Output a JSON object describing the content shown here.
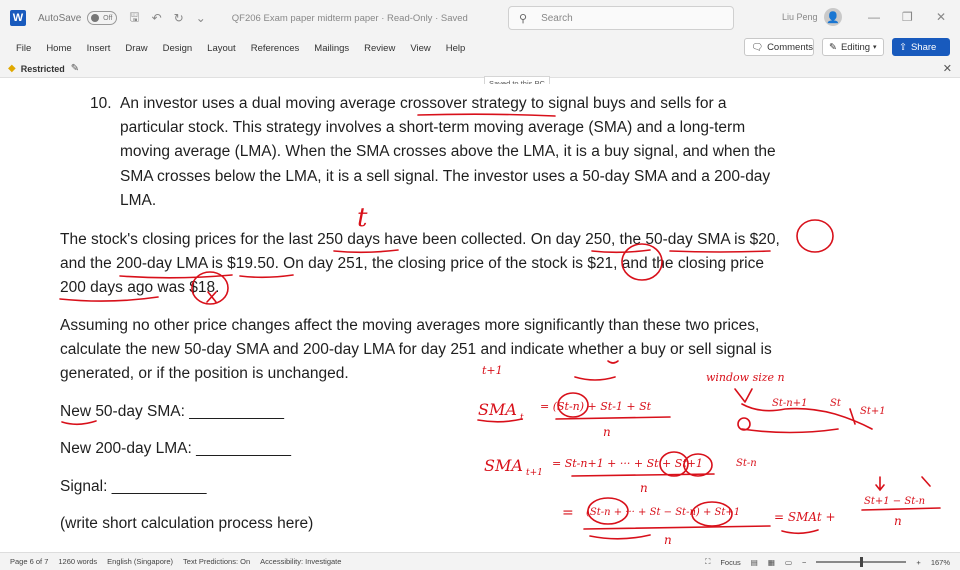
{
  "titlebar": {
    "app_letter": "W",
    "autosave_label": "AutoSave",
    "autosave_state": "Off",
    "doc_title": "QF206 Exam paper midterm paper  ·  Read-Only  ·  Saved",
    "search_placeholder": "Search",
    "user_name": "Liu Peng",
    "avatar_glyph": "👤"
  },
  "ribbon": {
    "tabs": [
      "File",
      "Home",
      "Insert",
      "Draw",
      "Design",
      "Layout",
      "References",
      "Mailings",
      "Review",
      "View",
      "Help"
    ],
    "comments_label": "Comments",
    "editing_label": "Editing",
    "share_label": "Share"
  },
  "restricted_bar": {
    "label": "Restricted"
  },
  "saved_tooltip": "Saved to this PC",
  "document": {
    "question_number": "10.",
    "question_lines": [
      "An investor uses a dual moving average crossover strategy to signal buys and sells for a",
      "particular stock. This strategy involves a short-term moving average (SMA) and a long-term",
      "moving average (LMA). When the SMA crosses above the LMA, it is a buy signal, and when the",
      "SMA crosses below the LMA, it is a sell signal. The investor uses a 50-day SMA and a 200-day",
      "LMA."
    ],
    "stock_lines": [
      "The stock's closing prices for the last 250 days have been collected. On day 250, the 50-day SMA is $20,",
      "and the 200-day LMA is $19.50. On day 251, the closing price of the stock is $21, and the closing price",
      "200 days ago was $18."
    ],
    "assume_lines": [
      "Assuming no other price changes affect the moving averages more significantly than these two prices,",
      "calculate the new 50-day SMA and 200-day LMA for day 251 and indicate whether a buy or sell signal is",
      "generated, or if the position is unchanged."
    ],
    "fill_lines": [
      "New 50-day SMA: ___________",
      "New 200-day LMA: ___________",
      "Signal: ___________",
      "(write short calculation process here)"
    ]
  },
  "annotations": {
    "t_mark": "t",
    "t_plus_1": "t+1",
    "window_size": "window size  n",
    "sma_t": "SMA",
    "sma_t_sub": "t",
    "eq1_rhs": "= (St-n) + St-1 + St",
    "eq1_den": "n",
    "sma_t1": "SMA",
    "sma_t1_sub": "t+1",
    "eq2_rhs": "= St-n+1 + ··· + St + St+1",
    "eq2_den": "n",
    "eq3_lhs": "=",
    "eq3_rhs": "(St-n + ··· + St − St-n) + St+1",
    "eq3_den": "n",
    "eq3_result": "= SMAt +",
    "eq3_frac_num": "St+1 − St-n",
    "eq3_frac_den": "n",
    "diagram_labels": [
      "St-n+1",
      "St",
      "St+1",
      "St-n"
    ]
  },
  "statusbar": {
    "page": "Page 6 of 7",
    "words": "1260 words",
    "language": "English (Singapore)",
    "predictions": "Text Predictions: On",
    "accessibility": "Accessibility: Investigate",
    "focus": "Focus",
    "zoom": "167%"
  }
}
